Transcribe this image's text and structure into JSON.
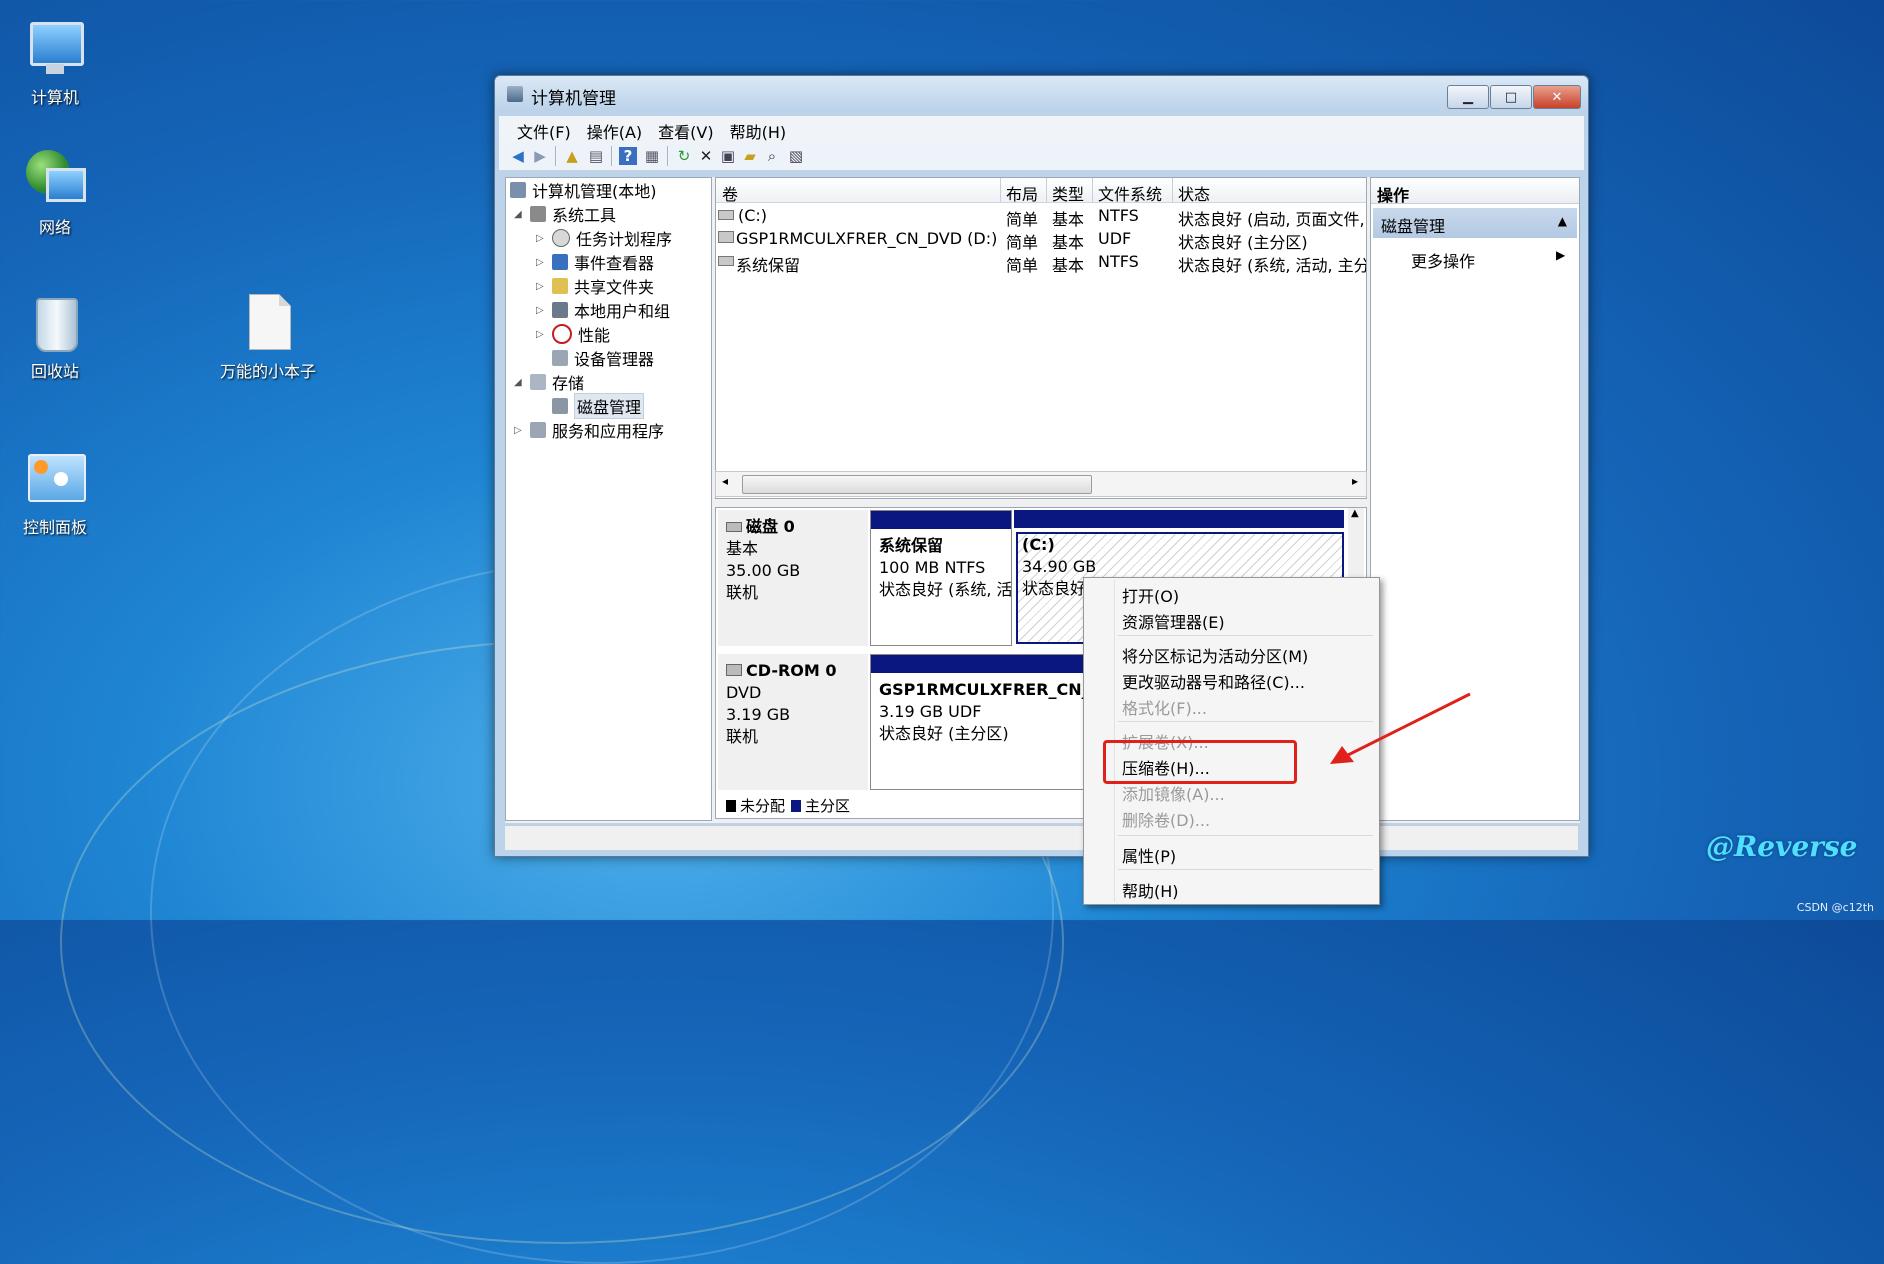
{
  "desktop": {
    "icons": [
      {
        "label": "计算机"
      },
      {
        "label": "网络"
      },
      {
        "label": "回收站"
      },
      {
        "label": "万能的小本子"
      },
      {
        "label": "控制面板"
      }
    ]
  },
  "window": {
    "title": "计算机管理",
    "controls": {
      "minimize": "▁",
      "maximize": "□",
      "close": "✕"
    },
    "menu": [
      "文件(F)",
      "操作(A)",
      "查看(V)",
      "帮助(H)"
    ]
  },
  "tree": {
    "root": "计算机管理(本地)",
    "system_tools": "系统工具",
    "task_scheduler": "任务计划程序",
    "event_viewer": "事件查看器",
    "shared_folders": "共享文件夹",
    "local_users": "本地用户和组",
    "performance": "性能",
    "device_manager": "设备管理器",
    "storage": "存储",
    "disk_management": "磁盘管理",
    "services_apps": "服务和应用程序"
  },
  "volumes": {
    "headers": [
      "卷",
      "布局",
      "类型",
      "文件系统",
      "状态"
    ],
    "rows": [
      {
        "name": "(C:)",
        "layout": "简单",
        "type": "基本",
        "fs": "NTFS",
        "status": "状态良好 (启动, 页面文件,"
      },
      {
        "name": "GSP1RMCULXFRER_CN_DVD (D:)",
        "layout": "简单",
        "type": "基本",
        "fs": "UDF",
        "status": "状态良好 (主分区)"
      },
      {
        "name": "系统保留",
        "layout": "简单",
        "type": "基本",
        "fs": "NTFS",
        "status": "状态良好 (系统, 活动, 主分"
      }
    ]
  },
  "disks": {
    "disk0": {
      "name": "磁盘 0",
      "kind": "基本",
      "size": "35.00 GB",
      "state": "联机"
    },
    "disk0_parts": {
      "reserved": {
        "name": "系统保留",
        "size": "100 MB NTFS",
        "status": "状态良好 (系统, 活"
      },
      "c": {
        "name": "(C:)",
        "size": "34.90 GB",
        "status": "状态良好"
      }
    },
    "cdrom": {
      "name": "CD-ROM 0",
      "kind": "DVD",
      "size": "3.19 GB",
      "state": "联机"
    },
    "cdrom_part": {
      "name": "GSP1RMCULXFRER_CN_D",
      "size": "3.19 GB UDF",
      "status": "状态良好 (主分区)"
    },
    "legend": {
      "unallocated": "未分配",
      "primary": "主分区"
    }
  },
  "actions": {
    "header": "操作",
    "section": "磁盘管理",
    "more": "更多操作"
  },
  "context_menu": {
    "open": "打开(O)",
    "explorer": "资源管理器(E)",
    "mark_active": "将分区标记为活动分区(M)",
    "change_letter": "更改驱动器号和路径(C)...",
    "format": "格式化(F)...",
    "extend": "扩展卷(X)...",
    "shrink": "压缩卷(H)...",
    "add_mirror": "添加镜像(A)...",
    "delete": "删除卷(D)...",
    "properties": "属性(P)",
    "help": "帮助(H)"
  },
  "watermark": "@Reverse",
  "credit": "CSDN @c12th",
  "colors": {
    "primary_partition": "#0a1780",
    "highlight": "#e0201a"
  }
}
